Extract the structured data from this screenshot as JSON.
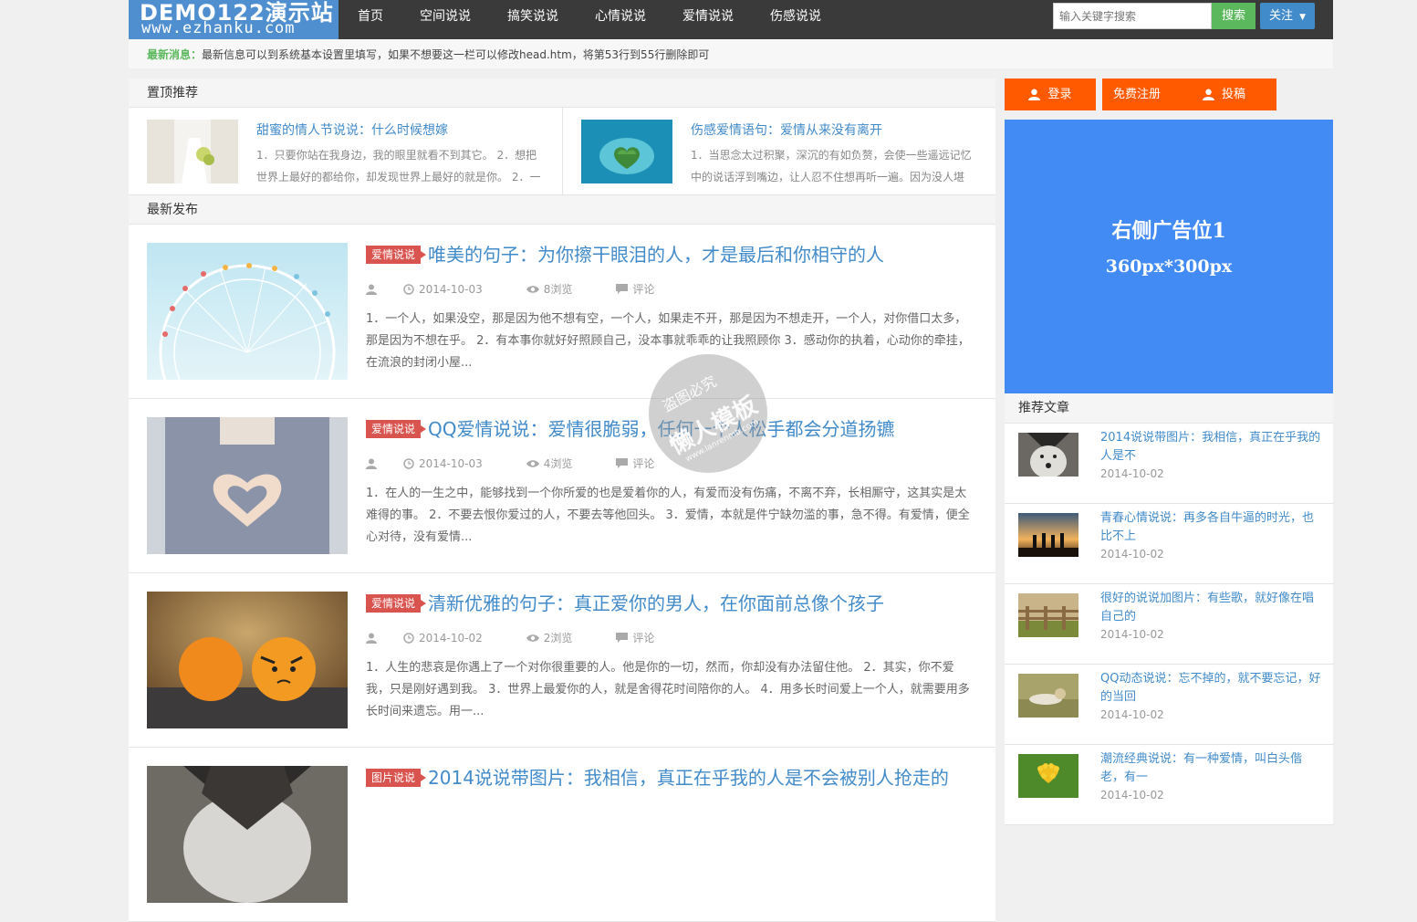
{
  "header": {
    "logo_line1": "DEMO122演示站",
    "logo_line2": "www.ezhanku.com",
    "nav": [
      "首页",
      "空间说说",
      "搞笑说说",
      "心情说说",
      "爱情说说",
      "伤感说说"
    ],
    "search_placeholder": "输入关键字搜索",
    "search_button": "搜索",
    "follow_button": "关注"
  },
  "newsbar": {
    "label": "最新消息：",
    "text": "最新信息可以到系统基本设置里填写，如果不想要这一栏可以修改head.htm，将第53行到55行删除即可"
  },
  "top_recommend": {
    "title": "置顶推荐",
    "items": [
      {
        "title": "甜蜜的情人节说说：什么时候想嫁",
        "desc": "1．只要你站在我身边，我的眼里就看不到其它。 2．想把世界上最好的都给你，却发现世界上最好的就是你。 2．一"
      },
      {
        "title": "伤感爱情语句：爱情从来没有离开",
        "desc": "1．当思念太过积聚，深沉的有如负赘，会使一些遥远记忆中的说话浮到嘴边，让人忍不住想再听一遍。因为没人堪"
      }
    ]
  },
  "latest": {
    "title": "最新发布",
    "posts": [
      {
        "category": "爱情说说",
        "title": "唯美的句子：为你擦干眼泪的人，才是最后和你相守的人",
        "date": "2014-10-03",
        "views": "8浏览",
        "comments": "评论",
        "desc": "1．一个人，如果没空，那是因为他不想有空，一个人，如果走不开，那是因为不想走开，一个人，对你借口太多，那是因为不想在乎。 2．有本事你就好好照顾自己，没本事就乖乖的让我照顾你 3．感动你的执着，心动你的牵挂，在流浪的封闭小屋..."
      },
      {
        "category": "爱情说说",
        "title": "QQ爱情说说：爱情很脆弱，任何一个人松手都会分道扬镳",
        "date": "2014-10-03",
        "views": "4浏览",
        "comments": "评论",
        "desc": "1．在人的一生之中，能够找到一个你所爱的也是爱着你的人，有爱而没有伤痛，不离不弃，长相厮守，这其实是太难得的事。 2．不要去恨你爱过的人，不要去等他回头。 3．爱情，本就是件宁缺勿滥的事，急不得。有爱情，便全心对待，没有爱情..."
      },
      {
        "category": "爱情说说",
        "title": "清新优雅的句子：真正爱你的男人，在你面前总像个孩子",
        "date": "2014-10-02",
        "views": "2浏览",
        "comments": "评论",
        "desc": "1．人生的悲哀是你遇上了一个对你很重要的人。他是你的一切，然而，你却没有办法留住他。 2．其实，你不爱我，只是刚好遇到我。 3．世界上最爱你的人，就是舍得花时间陪你的人。 4．用多长时间爱上一个人，就需要用多长时间来遗忘。用一..."
      },
      {
        "category": "图片说说",
        "title": "2014说说带图片：我相信，真正在乎我的人是不会被别人抢走的"
      }
    ]
  },
  "sidebar": {
    "login": "登录",
    "register": "免费注册",
    "submit": "投稿",
    "ad_line1": "右侧广告位1",
    "ad_line2": "360px*300px",
    "recommend_title": "推荐文章",
    "items": [
      {
        "title": "2014说说带图片：我相信，真正在乎我的人是不",
        "date": "2014-10-02"
      },
      {
        "title": "青春心情说说：再多各自牛逼的时光，也比不上",
        "date": "2014-10-02"
      },
      {
        "title": "很好的说说加图片：有些歌，就好像在唱自己的",
        "date": "2014-10-02"
      },
      {
        "title": "QQ动态说说：忘不掉的，就不要忘记，好的当回",
        "date": "2014-10-02"
      },
      {
        "title": "潮流经典说说：有一种爱情，叫白头偕老，有一",
        "date": "2014-10-02"
      }
    ]
  },
  "watermark": {
    "line1": "盗图必究",
    "line2": "懒人模板",
    "line3": "www.lanrenmb.com"
  }
}
